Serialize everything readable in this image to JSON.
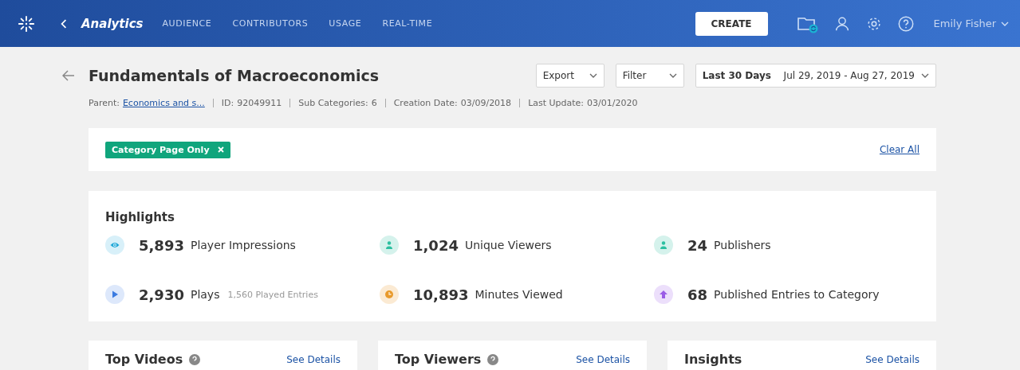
{
  "nav": {
    "section": "Analytics",
    "tabs": [
      "AUDIENCE",
      "CONTRIBUTORS",
      "USAGE",
      "REAL-TIME"
    ],
    "create": "CREATE",
    "user": "Emily Fisher"
  },
  "header": {
    "title": "Fundamentals of Macroeconomics",
    "export": "Export",
    "filter": "Filter",
    "range_label": "Last 30 Days",
    "range": "Jul 29, 2019 - Aug 27, 2019",
    "meta": [
      {
        "kind": "link",
        "label": "Parent:",
        "value": "Economics and s..."
      },
      {
        "kind": "text",
        "label": "ID:",
        "value": "92049911"
      },
      {
        "kind": "text",
        "label": "Sub Categories:",
        "value": "6"
      },
      {
        "kind": "text",
        "label": "Creation Date:",
        "value": "03/09/2018"
      },
      {
        "kind": "text",
        "label": "Last Update:",
        "value": "03/01/2020"
      }
    ]
  },
  "filters": {
    "tags": [
      "Category Page Only"
    ],
    "clear": "Clear All"
  },
  "highlights": {
    "title": "Highlights",
    "items": [
      {
        "kind": "eye",
        "color": "#1fa7d6",
        "value": "5,893",
        "label": "Player Impressions"
      },
      {
        "kind": "person",
        "color": "#2bbfa0",
        "value": "1,024",
        "label": "Unique Viewers"
      },
      {
        "kind": "person",
        "color": "#2bbfa0",
        "value": "24",
        "label": "Publishers"
      },
      {
        "kind": "play",
        "color": "#3b7be0",
        "value": "2,930",
        "label": "Plays",
        "sub": "1,560 Played Entries"
      },
      {
        "kind": "clock",
        "color": "#e89a2c",
        "value": "10,893",
        "label": "Minutes Viewed"
      },
      {
        "kind": "upload",
        "color": "#9a5ce6",
        "value": "68",
        "label": "Published Entries to Category"
      }
    ]
  },
  "cards": [
    {
      "title": "Top Videos",
      "help": true,
      "link": "See Details"
    },
    {
      "title": "Top Viewers",
      "help": true,
      "link": "See Details"
    },
    {
      "title": "Insights",
      "help": false,
      "link": "See Details"
    }
  ]
}
